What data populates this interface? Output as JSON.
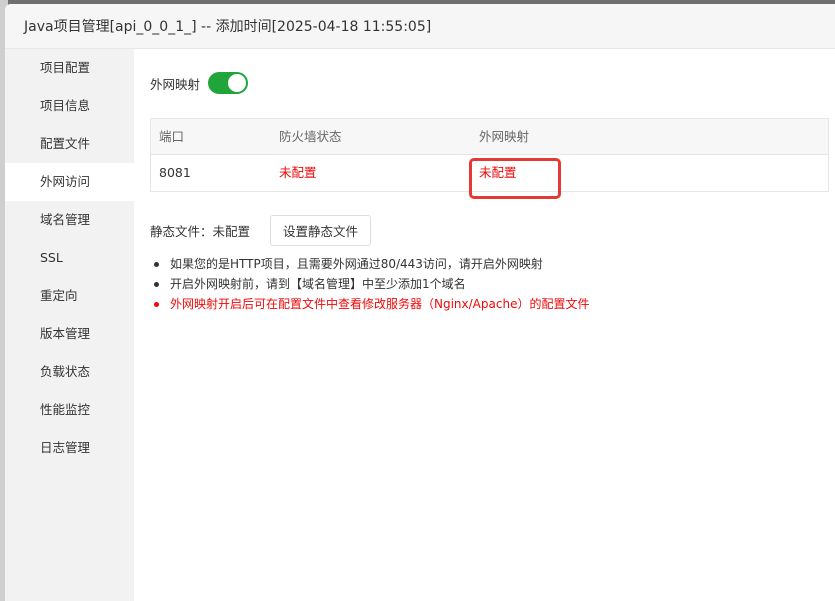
{
  "dialog": {
    "title": "Java项目管理[api_0_0_1_] -- 添加时间[2025-04-18 11:55:05]"
  },
  "sidebar": {
    "items": [
      {
        "label": "项目配置"
      },
      {
        "label": "项目信息"
      },
      {
        "label": "配置文件"
      },
      {
        "label": "外网访问",
        "active": true
      },
      {
        "label": "域名管理"
      },
      {
        "label": "SSL"
      },
      {
        "label": "重定向"
      },
      {
        "label": "版本管理"
      },
      {
        "label": "负载状态"
      },
      {
        "label": "性能监控"
      },
      {
        "label": "日志管理"
      }
    ]
  },
  "main": {
    "toggle_label": "外网映射",
    "toggle_on": true,
    "toggle_color": "#20a53a",
    "table": {
      "headers": [
        "端口",
        "防火墙状态",
        "外网映射"
      ],
      "rows": [
        [
          "8081",
          "未配置",
          "未配置"
        ]
      ]
    },
    "static_label": "静态文件：未配置",
    "static_button": "设置静态文件",
    "tips": [
      "如果您的是HTTP项目，且需要外网通过80/443访问，请开启外网映射",
      "开启外网映射前，请到【域名管理】中至少添加1个域名",
      "外网映射开启后可在配置文件中查看修改服务器（Nginx/Apache）的配置文件"
    ],
    "warning_color": "#ef0808"
  }
}
